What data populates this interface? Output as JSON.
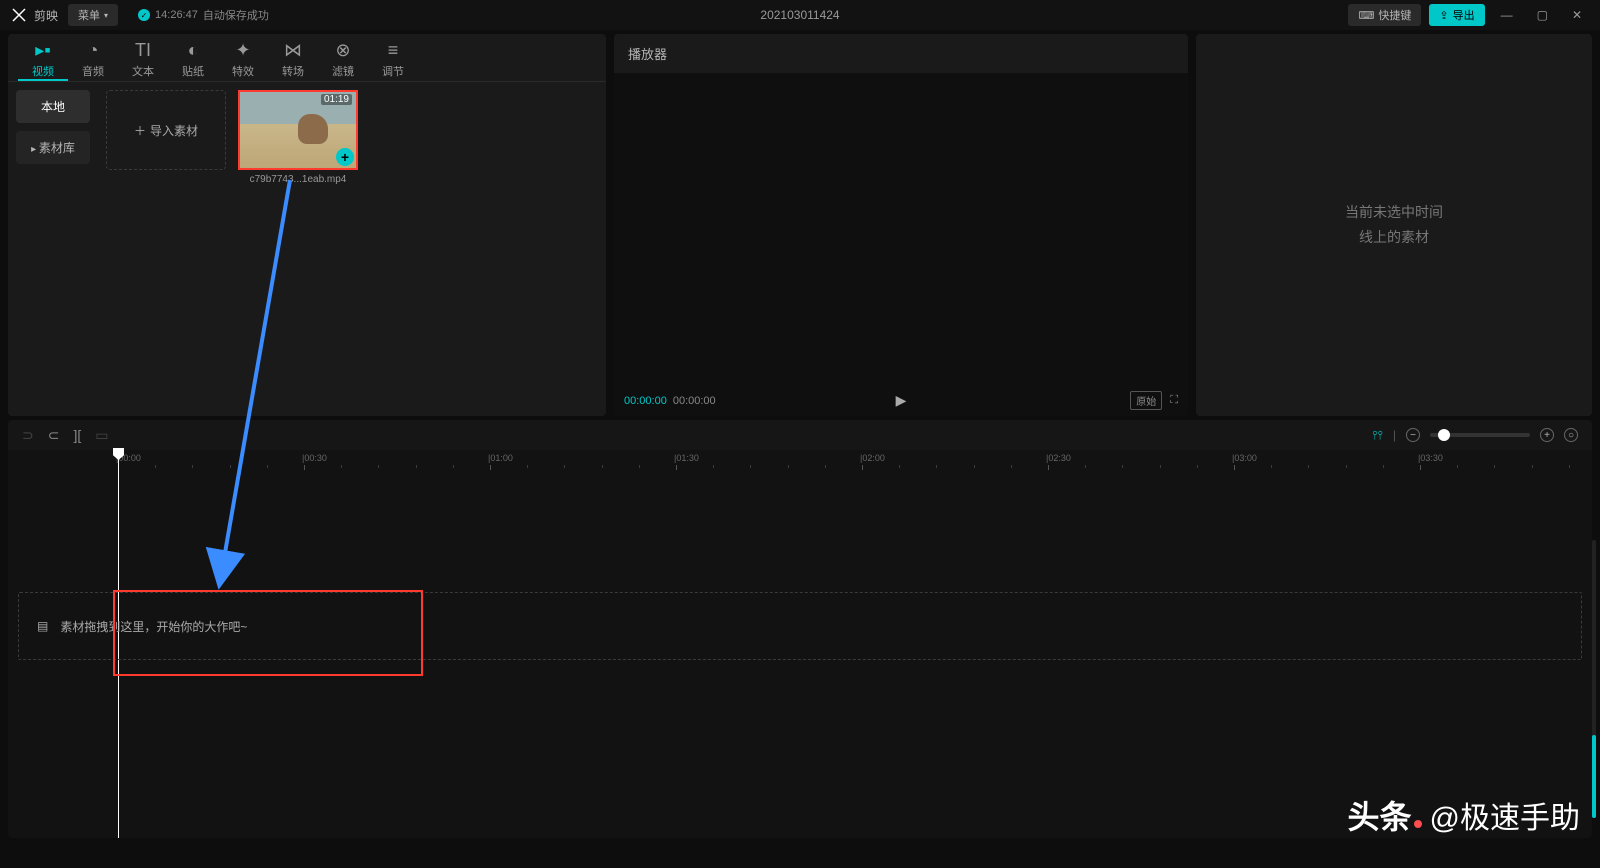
{
  "titlebar": {
    "app_name": "剪映",
    "menu_label": "菜单",
    "autosave_time": "14:26:47",
    "autosave_text": "自动保存成功",
    "project_name": "202103011424",
    "hotkey_label": "快捷键",
    "export_label": "导出"
  },
  "tabs": [
    {
      "icon": "video",
      "label": "视频",
      "active": true
    },
    {
      "icon": "audio",
      "label": "音频"
    },
    {
      "icon": "text",
      "label": "文本"
    },
    {
      "icon": "sticker",
      "label": "贴纸"
    },
    {
      "icon": "effect",
      "label": "特效"
    },
    {
      "icon": "transition",
      "label": "转场"
    },
    {
      "icon": "filter",
      "label": "滤镜"
    },
    {
      "icon": "adjust",
      "label": "调节"
    }
  ],
  "sidenav": {
    "local": "本地",
    "library": "素材库"
  },
  "media": {
    "import_label": "导入素材",
    "clip_duration": "01:19",
    "clip_name": "c79b7743...1eab.mp4"
  },
  "player": {
    "title": "播放器",
    "time_current": "00:00:00",
    "time_total": "00:00:00",
    "ratio_label": "原始"
  },
  "inspector": {
    "empty_line1": "当前未选中时间",
    "empty_line2": "线上的素材"
  },
  "timeline": {
    "ticks": [
      "00:00",
      "00:30",
      "01:00",
      "01:30",
      "02:00",
      "02:30",
      "03:00",
      "03:30"
    ],
    "drop_hint": "素材拖拽到这里，开始你的大作吧~"
  },
  "watermark": {
    "brand": "头条",
    "author": "@极速手助"
  }
}
